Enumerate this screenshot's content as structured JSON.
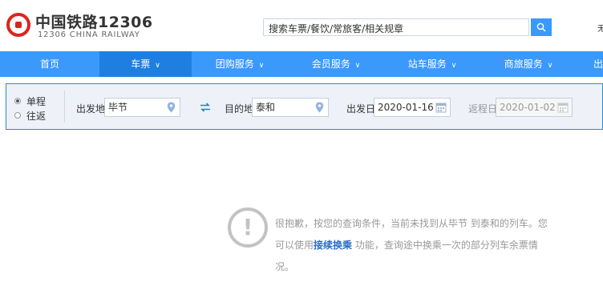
{
  "header": {
    "logo_title": "中国铁路12306",
    "logo_sub": "12306 CHINA RAILWAY",
    "search_placeholder": "搜索车票/餐饮/常旅客/相关规章",
    "right_edge_text": "无"
  },
  "nav": {
    "items": [
      "首页",
      "车票",
      "团购服务",
      "会员服务",
      "站车服务",
      "商旅服务",
      "出"
    ],
    "active_index": 1
  },
  "query": {
    "trip_types": [
      "单程",
      "往返"
    ],
    "selected_trip": "单程",
    "from_label": "出发地",
    "from_value": "毕节",
    "to_label": "目的地",
    "to_value": "泰和",
    "depart_label": "出发日",
    "depart_value": "2020-01-16",
    "return_label": "返程日",
    "return_value": "2020-01-02"
  },
  "notice": {
    "text_before": "很抱歉，按您的查询条件，当前未找到从毕节 到泰和的列车。您可以使用",
    "link_text": "接续换乘",
    "text_after": " 功能，查询途中换乘一次的部分列车余票情况。"
  },
  "colors": {
    "brand_red": "#d9261c",
    "nav_blue": "#3b99fc",
    "nav_active": "#1f7fe0",
    "link_blue": "#2b6cc4"
  }
}
